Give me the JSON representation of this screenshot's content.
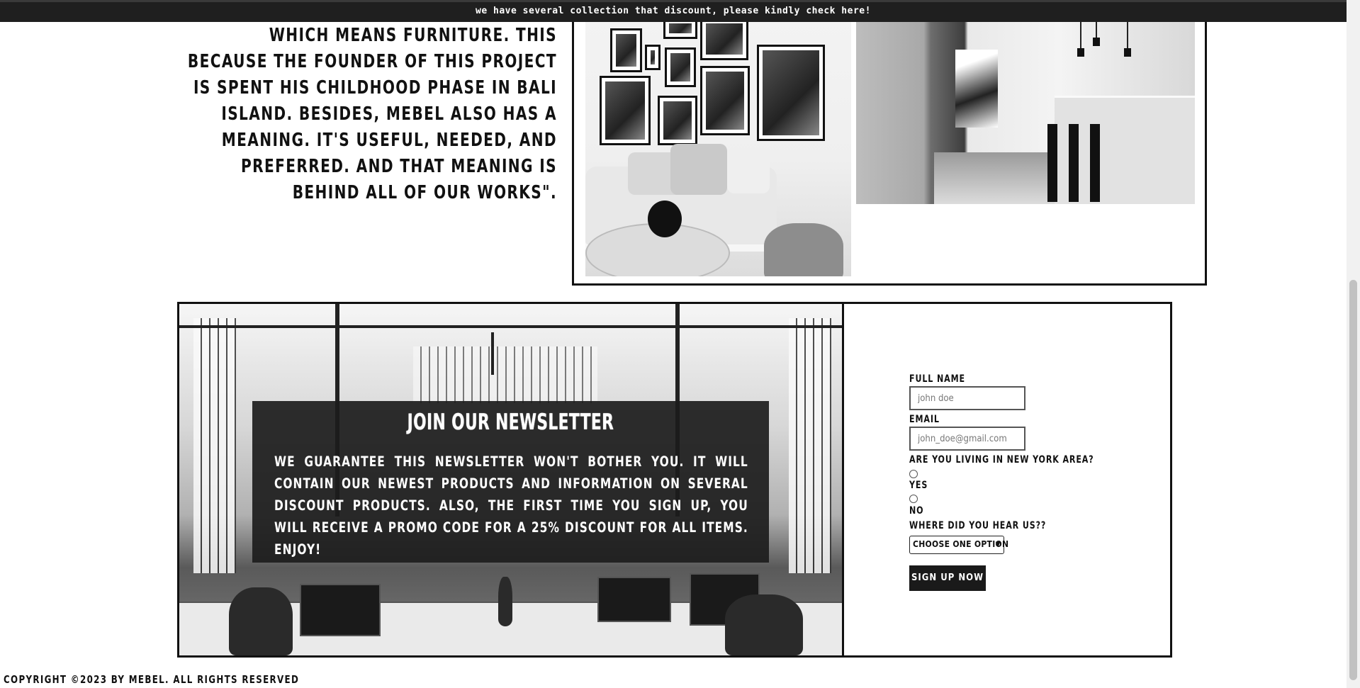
{
  "banner": {
    "text": "we have several collection that discount, please kindly check here!"
  },
  "about": {
    "quote": "WHICH MEANS FURNITURE. THIS BECAUSE THE FOUNDER OF THIS PROJECT IS SPENT HIS CHILDHOOD PHASE IN BALI ISLAND. BESIDES, MEBEL ALSO HAS A MEANING. IT'S USEFUL, NEEDED, AND PREFERRED. AND THAT MEANING IS BEHIND ALL OF OUR WORKS\"."
  },
  "newsletter": {
    "title": "JOIN OUR NEWSLETTER",
    "description": "We guarantee this newsletter won't bother you. It will contain our newest products and information on several discount products. Also, the first time you sign up, you will receive a promo code for a 25% discount for all items. Enjoy!"
  },
  "form": {
    "full_name_label": "FULL NAME",
    "full_name_placeholder": "john doe",
    "email_label": "EMAIL",
    "email_placeholder": "john_doe@gmail.com",
    "ny_question": "ARE YOU LIVING IN NEW YORK AREA?",
    "yes_label": "YES",
    "no_label": "NO",
    "hear_label": "WHERE DID YOU HEAR US??",
    "hear_selected": "CHOOSE ONE OPTION",
    "submit_label": "SIGN UP NOW"
  },
  "footer": {
    "copyright": "COPYRIGHT ©2023 BY MEBEL. ALL RIGHTS RESERVED"
  }
}
